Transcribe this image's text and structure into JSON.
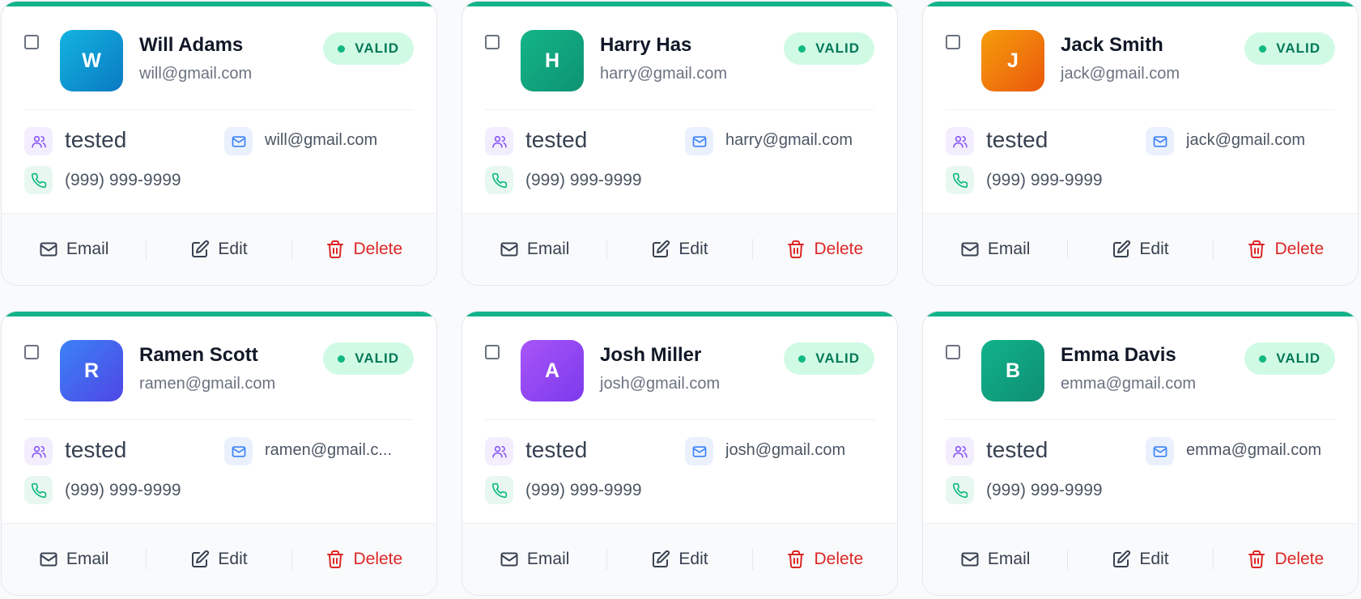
{
  "status_label": "VALID",
  "actions": {
    "email": "Email",
    "edit": "Edit",
    "delete": "Delete"
  },
  "colors": {
    "accent": "#10b38a",
    "badge_bg": "#d1fae5",
    "badge_text": "#047857",
    "delete": "#dc2626"
  },
  "icons": {
    "role": "users-icon",
    "email": "mail-icon",
    "phone": "phone-icon",
    "edit": "pencil-square-icon",
    "delete": "trash-icon"
  },
  "contacts": [
    {
      "initial": "W",
      "name": "Will Adams",
      "email": "will@gmail.com",
      "role": "tested",
      "card_email": "will@gmail.com",
      "phone": "(999) 999-9999",
      "status": "VALID",
      "avatar_colors": [
        "#12b4e0",
        "#0b79c2"
      ]
    },
    {
      "initial": "H",
      "name": "Harry Has",
      "email": "harry@gmail.com",
      "role": "tested",
      "card_email": "harry@gmail.com",
      "phone": "(999) 999-9999",
      "status": "VALID",
      "avatar_colors": [
        "#14b587",
        "#0d9373"
      ]
    },
    {
      "initial": "J",
      "name": "Jack Smith",
      "email": "jack@gmail.com",
      "role": "tested",
      "card_email": "jack@gmail.com",
      "phone": "(999) 999-9999",
      "status": "VALID",
      "avatar_colors": [
        "#f59e0b",
        "#ea580c"
      ]
    },
    {
      "initial": "R",
      "name": "Ramen Scott",
      "email": "ramen@gmail.com",
      "role": "tested",
      "card_email": "ramen@gmail.c...",
      "phone": "(999) 999-9999",
      "status": "VALID",
      "avatar_colors": [
        "#3b82f6",
        "#4f46e5"
      ]
    },
    {
      "initial": "A",
      "name": "Josh Miller",
      "email": "josh@gmail.com",
      "role": "tested",
      "card_email": "josh@gmail.com",
      "phone": "(999) 999-9999",
      "status": "VALID",
      "avatar_colors": [
        "#a855f7",
        "#7c3aed"
      ]
    },
    {
      "initial": "B",
      "name": "Emma Davis",
      "email": "emma@gmail.com",
      "role": "tested",
      "card_email": "emma@gmail.com",
      "phone": "(999) 999-9999",
      "status": "VALID",
      "avatar_colors": [
        "#10b38a",
        "#0f8f74"
      ]
    }
  ]
}
